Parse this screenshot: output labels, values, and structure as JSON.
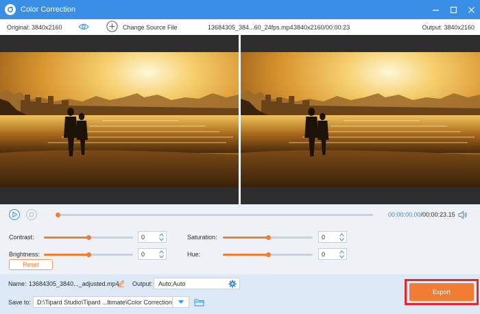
{
  "window": {
    "title": "Color Correction",
    "logo_icon": "app-logo-icon",
    "controls": [
      "minimize-icon",
      "maximize-icon",
      "close-icon"
    ]
  },
  "infobar": {
    "original_label": "Original: 3840x2160",
    "change_source_label": "Change Source File",
    "file_name": "13684305_384...60_24fps.mp4",
    "file_meta": "3840x2160/00:00:23",
    "output_label": "Output: 3840x2160"
  },
  "playback": {
    "current_time": "00:00:00.00",
    "total_time": "/00:00:23.15",
    "progress_fraction": 0.0
  },
  "adjustments": {
    "contrast": {
      "label": "Contrast:",
      "value": "0",
      "level": 0.5
    },
    "brightness": {
      "label": "Brightness:",
      "value": "0",
      "level": 0.5
    },
    "saturation": {
      "label": "Saturation:",
      "value": "0",
      "level": 0.5
    },
    "hue": {
      "label": "Hue:",
      "value": "0",
      "level": 0.5
    },
    "reset_label": "Reset"
  },
  "output_panel": {
    "name_label": "Name:",
    "name_value": "13684305_3840..._adjusted.mp4",
    "output_label": "Output:",
    "output_value": "Auto;Auto",
    "save_label": "Save to:",
    "save_path": "D:\\Tipard Studio\\Tipard ...ltimate\\Color Correction",
    "export_label": "Export"
  },
  "colors": {
    "accent": "#3a8ee6",
    "orange": "#f07d33",
    "highlight_outline": "#e8262a"
  }
}
